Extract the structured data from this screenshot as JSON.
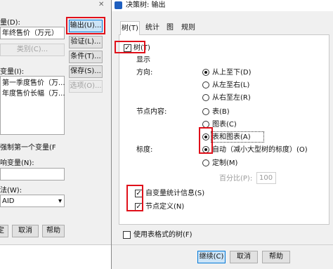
{
  "left_dialog": {
    "target_label": "量(D):",
    "target_value": "年终售价（万元）",
    "category_button": "类别(C)...",
    "independent_label": "变量(I):",
    "independent_items": [
      "第一季度售价（万...",
      "年度售价长幅（万..."
    ],
    "force_first_label": "强制第一个变量(F",
    "influence_label": "响变量(N):",
    "method_label": "法(W):",
    "method_value": "AID",
    "footer_buttons": [
      "定",
      "取消",
      "帮助"
    ],
    "side_buttons": [
      "输出(U)...",
      "验证(L)...",
      "条件(T)...",
      "保存(S)...",
      "选项(O)..."
    ]
  },
  "right_dialog": {
    "title": "决策树: 输出",
    "tabs": [
      "树(T)",
      "统计",
      "图",
      "规则"
    ],
    "tree_checkbox": "树(T)",
    "display_label": "显示",
    "direction_label": "方向:",
    "direction_options": [
      "从上至下(D)",
      "从左至右(L)",
      "从右至左(R)"
    ],
    "node_content_label": "节点内容:",
    "node_content_options": [
      "表(B)",
      "图表(C)",
      "表和图表(A)"
    ],
    "scale_label": "标度:",
    "scale_options": [
      "自动（减小大型树的标度）(O)",
      "定制(M)"
    ],
    "percent_label": "百分比(P):",
    "percent_value": "100",
    "checks": [
      "自变量统计信息(S)",
      "节点定义(N)"
    ],
    "table_format_checkbox": "使用表格式的树(F)",
    "footer_buttons": [
      "继续(C)",
      "取消",
      "帮助"
    ]
  },
  "colors": {
    "highlight_red": "#e0101a",
    "title_icon_blue": "#1f5fbf"
  }
}
